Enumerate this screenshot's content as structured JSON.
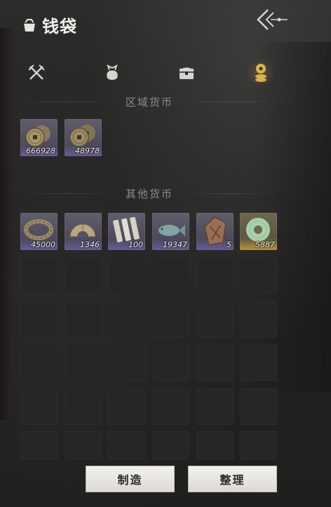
{
  "header": {
    "title": "钱袋",
    "title_icon": "pouch-icon",
    "back_icon": "back-arrow-icon"
  },
  "tabs": [
    {
      "icon": "swords-icon",
      "active": false
    },
    {
      "icon": "pouch-icon",
      "active": false
    },
    {
      "icon": "chest-icon",
      "active": false
    },
    {
      "icon": "coins-icon",
      "active": true
    }
  ],
  "sections": {
    "regional": {
      "title": "区域货币",
      "items": [
        {
          "icon": "copper-coins-icon",
          "quantity": "666928"
        },
        {
          "icon": "copper-coins-icon",
          "quantity": "48978"
        }
      ]
    },
    "other": {
      "title": "其他货币",
      "items": [
        {
          "icon": "metal-ring-icon",
          "quantity": "45000"
        },
        {
          "icon": "half-disc-icon",
          "quantity": "1346"
        },
        {
          "icon": "bamboo-slips-icon",
          "quantity": "100"
        },
        {
          "icon": "jade-fish-icon",
          "quantity": "19347"
        },
        {
          "icon": "bronze-token-icon",
          "quantity": "5"
        },
        {
          "icon": "jade-bi-disc-icon",
          "quantity": "5887",
          "rarity": "gold"
        }
      ]
    }
  },
  "buttons": {
    "craft": "制造",
    "sort": "整理"
  },
  "colors": {
    "accent": "#d9b24a",
    "slot_purple": "#55506a",
    "slot_gold": "#8c7a3a"
  }
}
